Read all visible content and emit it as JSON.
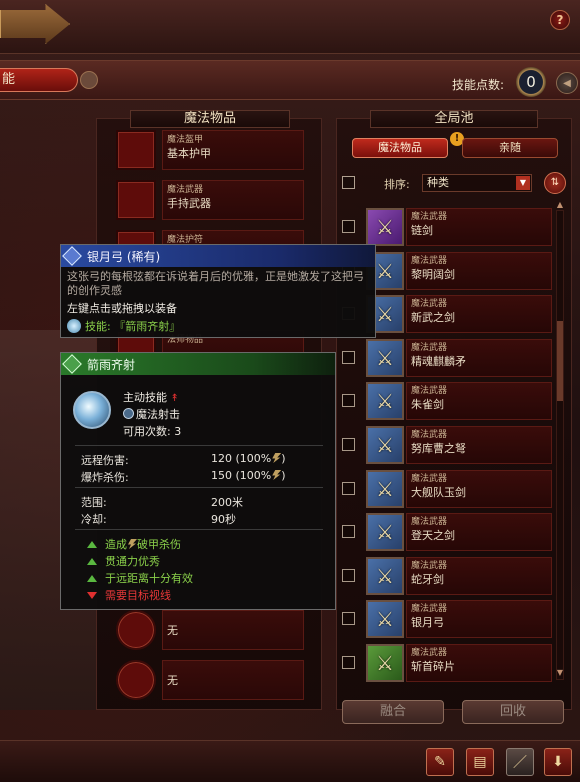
{
  "header": {
    "help": "?"
  },
  "skillbar": {
    "tab_label": "能",
    "points_label": "技能点数:",
    "points_value": "0"
  },
  "left_panel": {
    "title": "魔法物品",
    "slots": [
      {
        "category": "魔法盔甲",
        "name": "基本护甲"
      },
      {
        "category": "魔法武器",
        "name": "手持武器"
      },
      {
        "category": "魔法护符",
        "name": ""
      },
      {
        "category": "法师物品",
        "name": ""
      },
      {
        "category": "",
        "name": "无"
      },
      {
        "category": "",
        "name": "无"
      }
    ]
  },
  "right_panel": {
    "title": "全局池",
    "tabs": [
      {
        "label": "魔法物品",
        "active": true
      },
      {
        "label": "亲随",
        "active": false
      }
    ],
    "sort_label": "排序:",
    "sort_value": "种类",
    "items": [
      {
        "category": "魔法武器",
        "name": "链剑",
        "color": "purple"
      },
      {
        "category": "魔法武器",
        "name": "黎明阔剑",
        "color": "blue"
      },
      {
        "category": "魔法武器",
        "name": "新武之剑",
        "color": "blue"
      },
      {
        "category": "魔法武器",
        "name": "精魂麒麟矛",
        "color": "blue"
      },
      {
        "category": "魔法武器",
        "name": "朱雀剑",
        "color": "blue"
      },
      {
        "category": "魔法武器",
        "name": "努库曹之弩",
        "color": "blue"
      },
      {
        "category": "魔法武器",
        "name": "大舰队玉剑",
        "color": "blue"
      },
      {
        "category": "魔法武器",
        "name": "登天之剑",
        "color": "blue"
      },
      {
        "category": "魔法武器",
        "name": "蛇牙剑",
        "color": "blue"
      },
      {
        "category": "魔法武器",
        "name": "银月弓",
        "color": "blue"
      },
      {
        "category": "魔法武器",
        "name": "斩首碎片",
        "color": "green"
      }
    ],
    "merge_label": "融合",
    "recycle_label": "回收"
  },
  "tooltip_item": {
    "title": "银月弓 (稀有)",
    "description": "这张弓的每根弦都在诉说着月后的优雅，正是她激发了这把弓的创作灵感",
    "hint": "左键点击或拖拽以装备",
    "skill": "技能: 『箭雨齐射』"
  },
  "tooltip_skill": {
    "title": "箭雨齐射",
    "type": "主动技能",
    "cast": "魔法射击",
    "uses": "可用次数: 3",
    "stats": [
      {
        "label": "远程伤害:",
        "value": "120 (100%"
      },
      {
        "label": "爆炸杀伤:",
        "value": "150 (100%"
      }
    ],
    "stats2": [
      {
        "label": "范围:",
        "value": "200米"
      },
      {
        "label": "冷却:",
        "value": "90秒"
      }
    ],
    "traits": [
      {
        "pre": "造成",
        "post": "破甲杀伤",
        "good": true
      },
      {
        "pre": "贯通力优秀",
        "post": "",
        "good": true
      },
      {
        "pre": "于远距离十分有效",
        "post": "",
        "good": true
      },
      {
        "pre": "需要目标视线",
        "post": "",
        "good": false
      }
    ]
  },
  "colors": {
    "accent_red": "#b02418",
    "good_green": "#8ad04a",
    "bad_red": "#e83838"
  }
}
